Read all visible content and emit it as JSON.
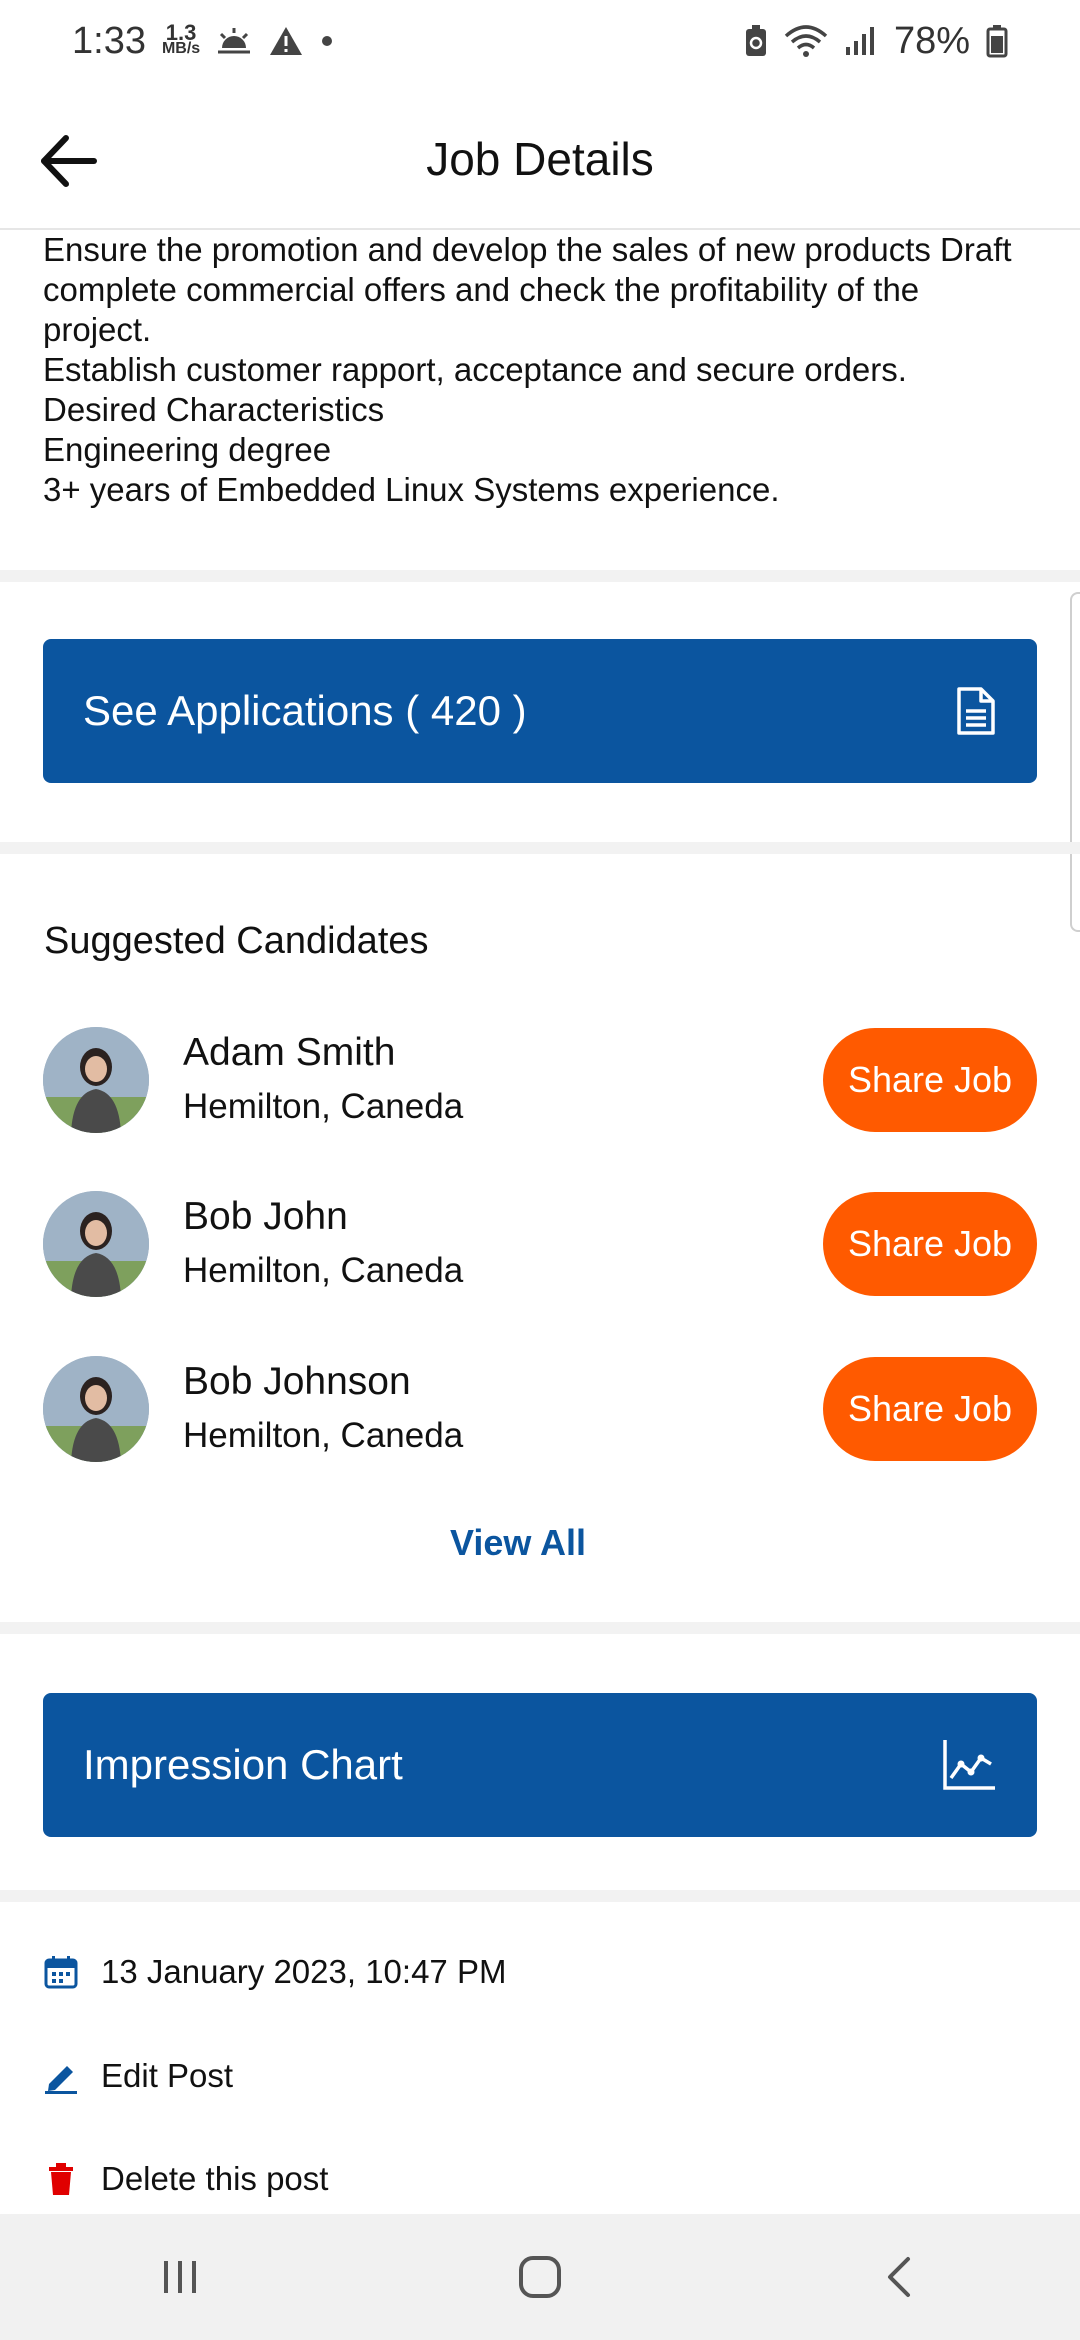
{
  "status": {
    "time": "1:33",
    "speed_value": "1.3",
    "speed_unit": "MB/s",
    "battery": "78%"
  },
  "header": {
    "title": "Job Details"
  },
  "description_lines": [
    "Ensure the promotion and develop the sales of new products Draft",
    "complete commercial offers and check the profitability of the",
    "project.",
    "Establish customer rapport, acceptance and secure orders.",
    "Desired Characteristics",
    "Engineering degree",
    "3+ years of Embedded Linux Systems experience."
  ],
  "applications_button": {
    "label": "See Applications ( 420 )",
    "icon": "document-icon"
  },
  "suggested": {
    "title": "Suggested Candidates",
    "candidates": [
      {
        "name": "Adam Smith",
        "location": "Hemilton, Caneda",
        "action": "Share Job"
      },
      {
        "name": "Bob John",
        "location": "Hemilton, Caneda",
        "action": "Share Job"
      },
      {
        "name": "Bob Johnson",
        "location": "Hemilton, Caneda",
        "action": "Share Job"
      }
    ],
    "view_all": "View All"
  },
  "impression_button": {
    "label": "Impression Chart",
    "icon": "line-chart-icon"
  },
  "meta": {
    "posted_date": "13 January 2023, 10:47 PM",
    "edit_label": "Edit Post",
    "delete_label": "Delete this post"
  },
  "colors": {
    "primary_blue": "#0b559f",
    "accent_orange": "#ff5a00",
    "delete_red": "#e00000"
  }
}
